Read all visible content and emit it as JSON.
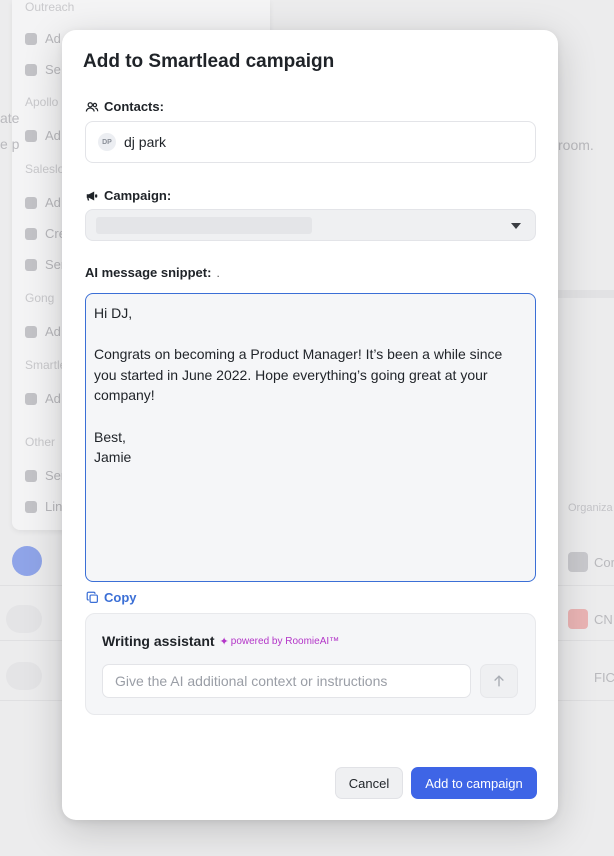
{
  "background": {
    "menu": {
      "sections": [
        "Outreach",
        "Apollo",
        "Salesloft",
        "Gong",
        "Smartlead",
        "Other"
      ],
      "items": [
        "Ad",
        "Se",
        "Ad",
        "Ad",
        "Cre",
        "Ser",
        "Ad",
        "Ad",
        "Sen",
        "Link",
        "Co"
      ]
    },
    "right_texts": [
      "ate",
      "e p",
      "room.",
      "Organiza",
      "Cor",
      "CN",
      "FIC"
    ]
  },
  "modal": {
    "title": "Add to Smartlead campaign",
    "contacts": {
      "label": "Contacts:",
      "avatar_initials": "DP",
      "name": "dj park"
    },
    "campaign": {
      "label": "Campaign:",
      "selected": ""
    },
    "snippet": {
      "label": "AI message snippet:",
      "marker": ".",
      "text": "Hi DJ,\n\nCongrats on becoming a Product Manager! It’s been a while since you started in June 2022. Hope everything’s going great at your company!\n\nBest,\nJamie"
    },
    "copy_label": "Copy",
    "assistant": {
      "title": "Writing assistant",
      "powered_by": "powered by RoomieAI™",
      "input_placeholder": "Give the AI additional context or instructions",
      "input_value": ""
    },
    "buttons": {
      "cancel": "Cancel",
      "primary": "Add to campaign"
    }
  },
  "colors": {
    "accent": "#3e65e6",
    "focus_border": "#3b6fd6",
    "powered_by": "#b335c8"
  }
}
